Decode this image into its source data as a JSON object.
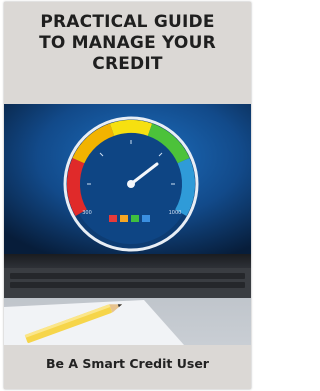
{
  "cover": {
    "title_lines": [
      "PRACTICAL GUIDE",
      "TO MANAGE YOUR",
      "CREDIT"
    ],
    "subtitle": "Be A Smart Credit User",
    "gauge": {
      "min_label": "300",
      "max_label": "1000",
      "arc_colors": [
        "#e02a2a",
        "#f2b300",
        "#f6e010",
        "#4cc23a",
        "#2f9bd8"
      ],
      "legend_squares": [
        "#e63a3a",
        "#f5a623",
        "#3fbf3f",
        "#3a8fe0"
      ]
    },
    "colors": {
      "background": "#dbd8d5",
      "screen": "#0f4c92"
    }
  }
}
